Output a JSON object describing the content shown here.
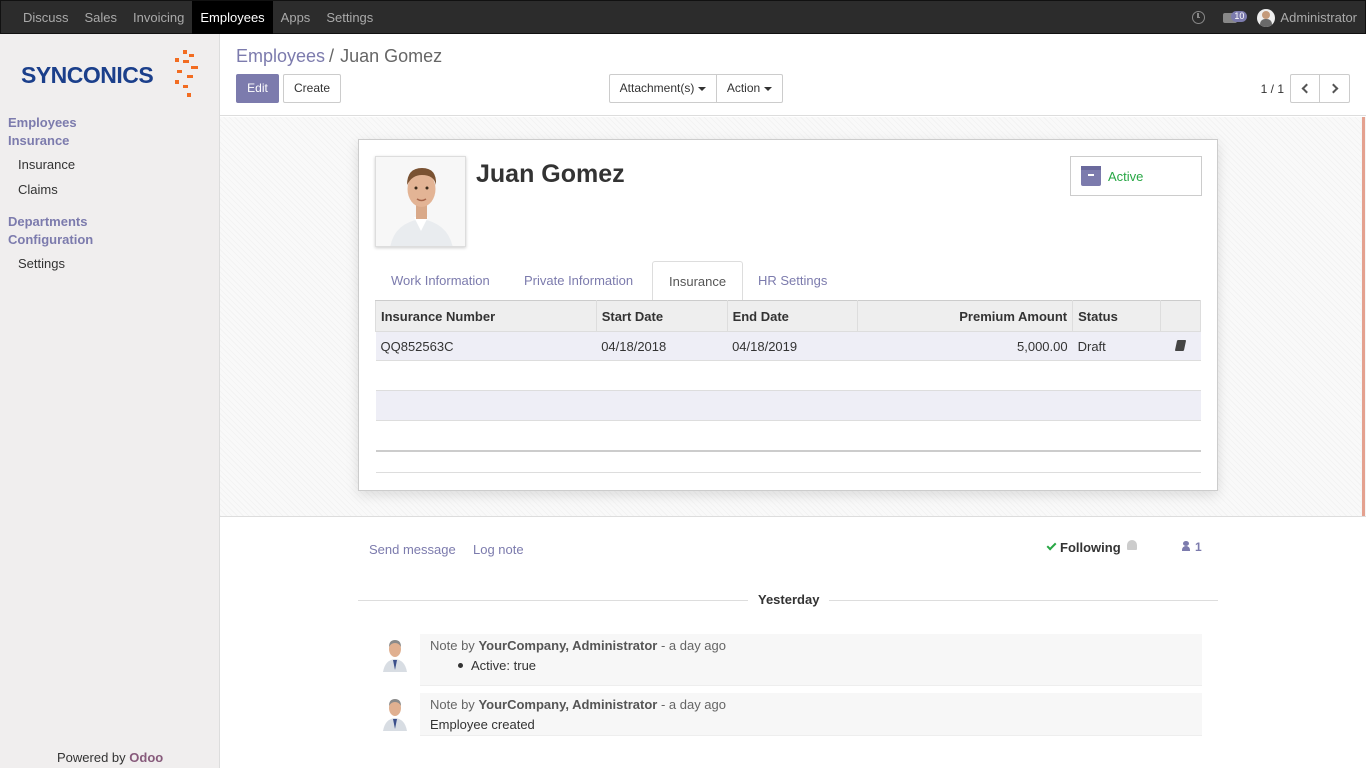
{
  "topbar": {
    "menu": [
      "Discuss",
      "Sales",
      "Invoicing",
      "Employees",
      "Apps",
      "Settings"
    ],
    "active_menu": "Employees",
    "message_count": "10",
    "user_name": "Administrator"
  },
  "sidebar": {
    "logo_text": "SYNCONICS",
    "section_employees": "Employees",
    "section_insurance": "Insurance",
    "item_insurance": "Insurance",
    "item_claims": "Claims",
    "section_departments": "Departments",
    "section_configuration": "Configuration",
    "item_settings": "Settings",
    "powered_by": "Powered by",
    "powered_brand": "Odoo"
  },
  "control_panel": {
    "breadcrumb_parent": "Employees",
    "breadcrumb_separator": "/",
    "breadcrumb_current": "Juan Gomez",
    "edit_label": "Edit",
    "create_label": "Create",
    "attachments_label": "Attachment(s)",
    "action_label": "Action",
    "pager": "1 / 1"
  },
  "form": {
    "employee_name": "Juan Gomez",
    "active_label": "Active",
    "tabs": [
      "Work Information",
      "Private Information",
      "Insurance",
      "HR Settings"
    ],
    "active_tab": "Insurance",
    "table_headers": [
      "Insurance Number",
      "Start Date",
      "End Date",
      "Premium Amount",
      "Status"
    ],
    "rows": [
      {
        "insurance_number": "QQ852563C",
        "start_date": "04/18/2018",
        "end_date": "04/18/2019",
        "premium_amount": "5,000.00",
        "status": "Draft"
      }
    ]
  },
  "chatter": {
    "send_message": "Send message",
    "log_note": "Log note",
    "following_label": "Following",
    "follower_count": "1",
    "day_label": "Yesterday",
    "messages": [
      {
        "prefix": "Note by",
        "author": "YourCompany, Administrator",
        "time": "- a day ago",
        "body": "Active: true"
      },
      {
        "prefix": "Note by",
        "author": "YourCompany, Administrator",
        "time": "- a day ago",
        "body": "Employee created"
      }
    ]
  },
  "colors": {
    "primary": "#7c7bad",
    "topbar": "#2c2c2c",
    "active_green": "#28a745",
    "logo_blue": "#1b3f8b",
    "logo_orange": "#f26c21"
  }
}
